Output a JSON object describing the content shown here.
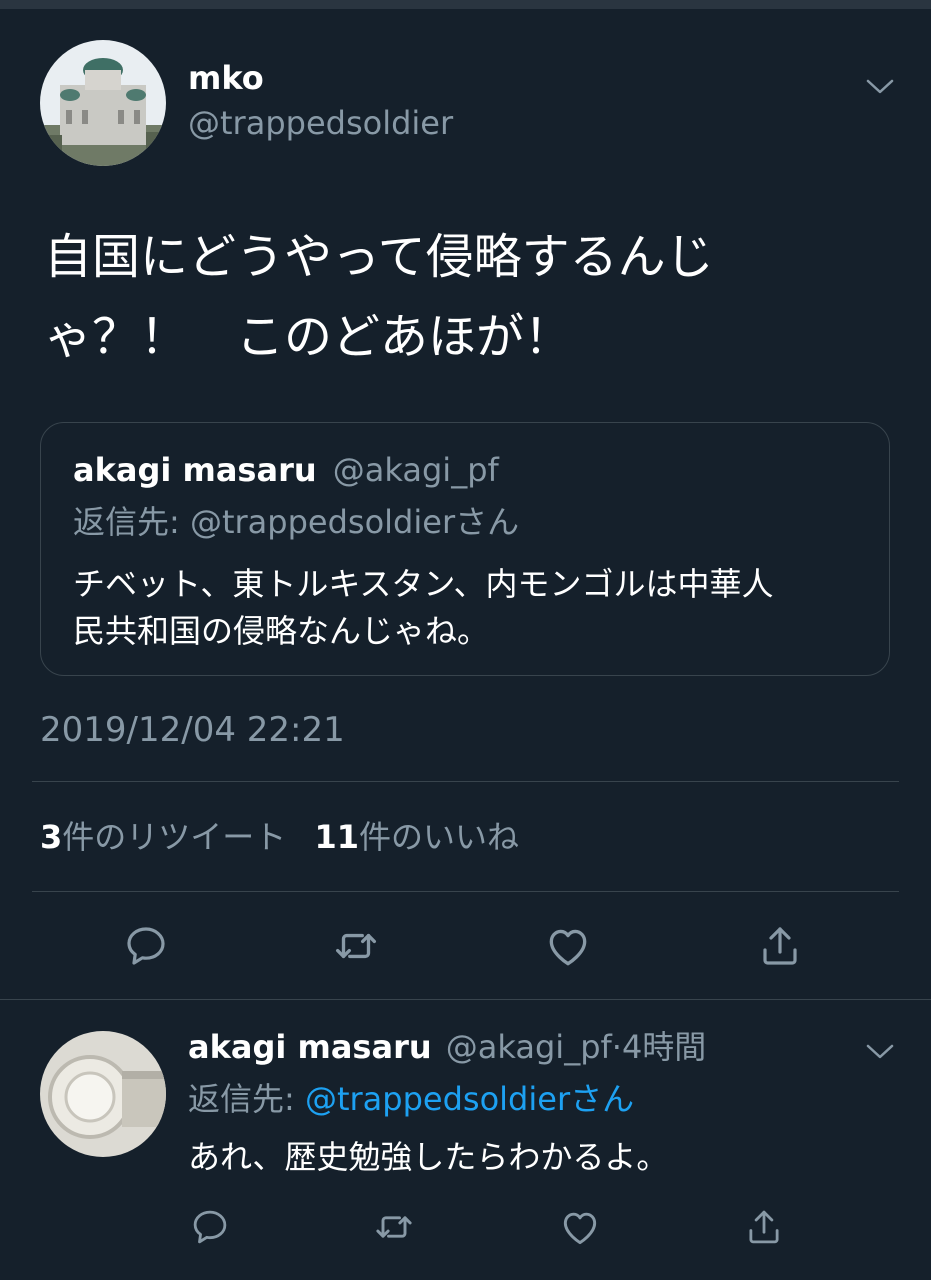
{
  "tweet": {
    "author_name": "mko",
    "author_handle": "@trappedsoldier",
    "text_line1": "自国にどうやって侵略するんじ",
    "text_line2": "ゃ？！　このどあほが！",
    "quote": {
      "author_name": "akagi masaru",
      "author_handle": "@akagi_pf",
      "reply_to_prefix": "返信先: ",
      "reply_to_handle": "@trappedsoldier",
      "reply_to_suffix": "さん",
      "text_line1": "チベット、東トルキスタン、内モンゴルは中華人",
      "text_line2": "民共和国の侵略なんじゃね。"
    },
    "timestamp": "2019/12/04 22:21",
    "retweet_count": "3",
    "retweet_label": "件のリツイート",
    "like_count": "11",
    "like_label": "件のいいね"
  },
  "reply": {
    "author_name": "akagi masaru",
    "author_handle": "@akagi_pf",
    "separator": "·",
    "time": "4時間",
    "reply_to_prefix": "返信先: ",
    "reply_to_handle": "@trappedsoldier",
    "reply_to_suffix": "さん",
    "text": "あれ、歴史勉強したらわかるよ。"
  },
  "icons": [
    "chevron-down-icon",
    "reply-icon",
    "retweet-icon",
    "like-icon",
    "share-icon"
  ],
  "colors": {
    "background": "#15202b",
    "muted": "#8899a6",
    "link": "#1da1f2",
    "divider": "#38444d"
  }
}
